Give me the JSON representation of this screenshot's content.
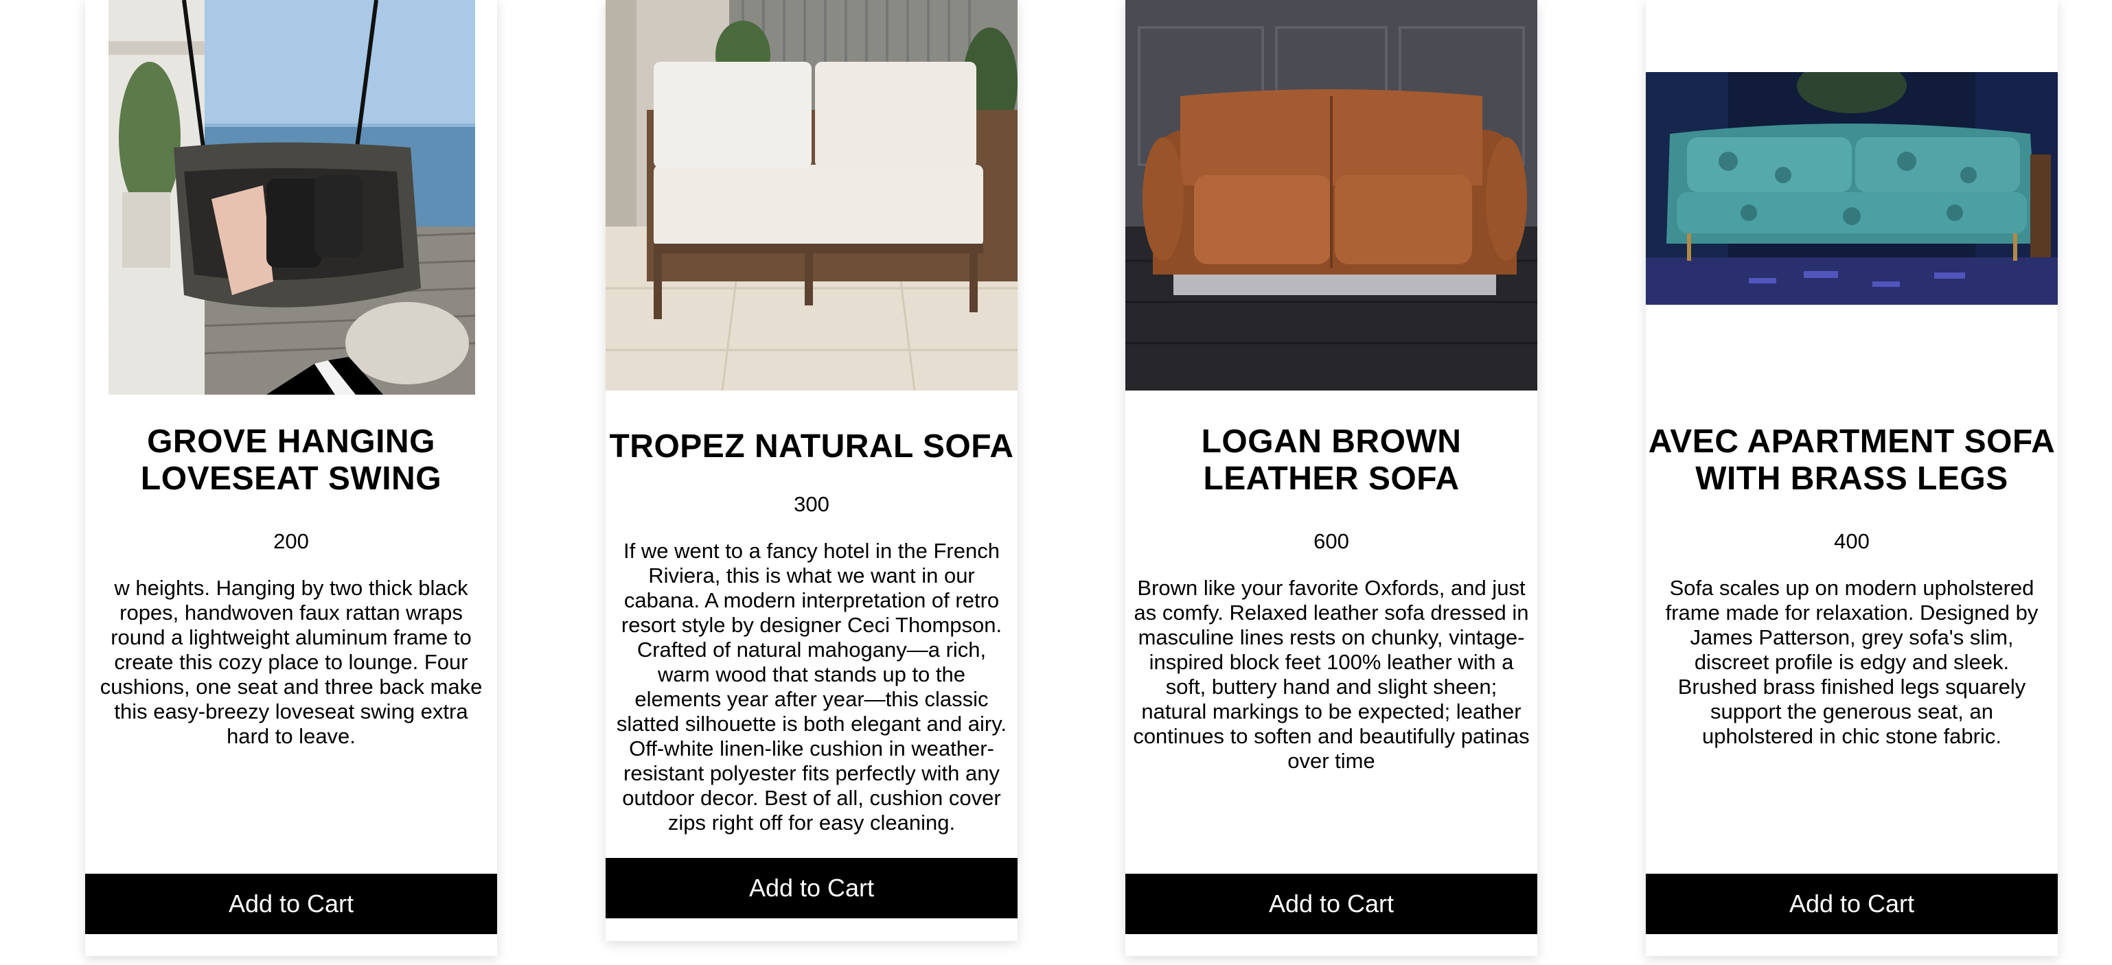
{
  "products": [
    {
      "title": "GROVE HANGING LOVESEAT SWING",
      "price": "200",
      "description": "w heights. Hanging by two thick black ropes, handwoven faux rattan wraps round a lightweight aluminum frame to create this cozy place to lounge. Four cushions, one seat and three back make this easy-breezy loveseat swing extra hard to leave.",
      "button": "Add to Cart"
    },
    {
      "title": "TROPEZ NATURAL SOFA",
      "price": "300",
      "description": "If we went to a fancy hotel in the French Riviera, this is what we want in our cabana. A modern interpretation of retro resort style by designer Ceci Thompson. Crafted of natural mahogany—a rich, warm wood that stands up to the elements year after year—this classic slatted silhouette is both elegant and airy. Off-white linen-like cushion in weather-resistant polyester fits perfectly with any outdoor decor. Best of all, cushion cover zips right off for easy cleaning.",
      "button": "Add to Cart"
    },
    {
      "title": "LOGAN BROWN LEATHER SOFA",
      "price": "600",
      "description": "Brown like your favorite Oxfords, and just as comfy. Relaxed leather sofa dressed in masculine lines rests on chunky, vintage-inspired block feet 100% leather with a soft, buttery hand and slight sheen; natural markings to be expected; leather continues to soften and beautifully patinas over time",
      "button": "Add to Cart"
    },
    {
      "title": "AVEC APARTMENT SOFA WITH BRASS LEGS",
      "price": "400",
      "description": "Sofa scales up on modern upholstered frame made for relaxation. Designed by James Patterson, grey sofa's slim, discreet profile is edgy and sleek. Brushed brass finished legs squarely support the generous seat, an upholstered in chic stone fabric.",
      "button": "Add to Cart"
    }
  ],
  "colors": {
    "button_bg": "#000000",
    "button_text": "#ffffff",
    "card_bg": "#ffffff"
  }
}
